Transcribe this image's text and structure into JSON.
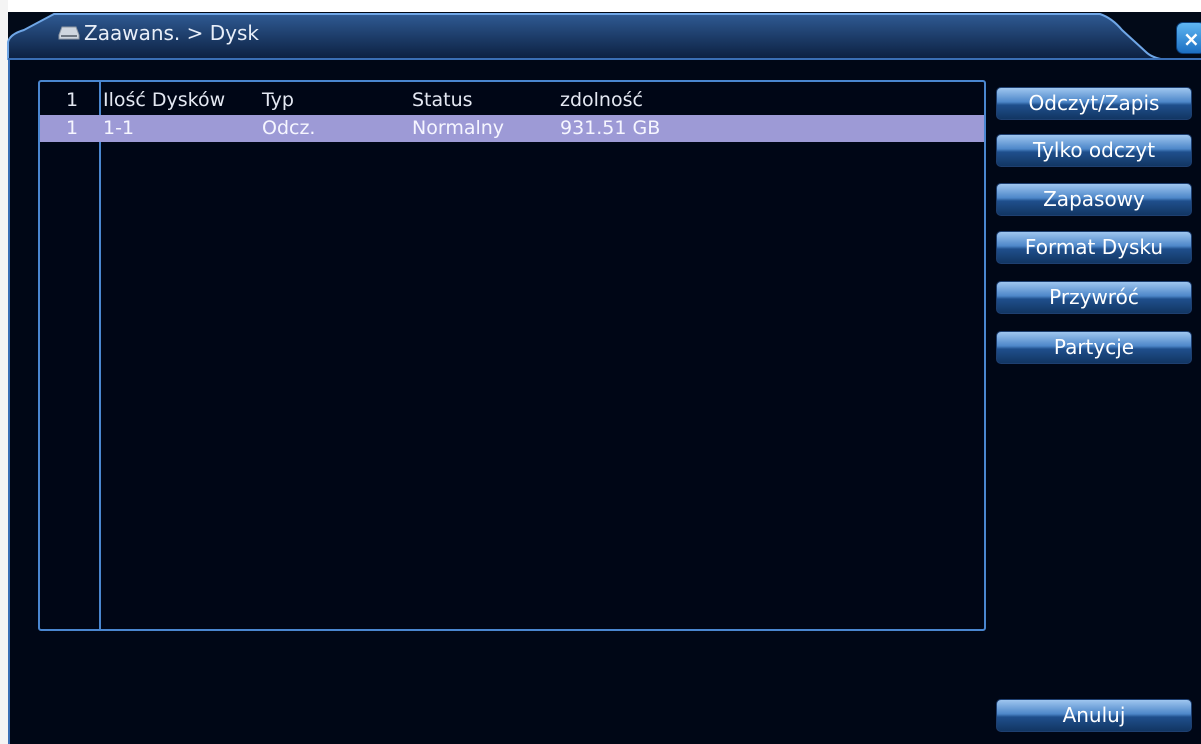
{
  "window": {
    "title": "Zaawans. > Dysk",
    "close_label": "×"
  },
  "table": {
    "headers": [
      "1",
      "Ilość Dysków",
      "Typ",
      "Status",
      "zdolność"
    ],
    "rows": [
      {
        "index": "1",
        "disks": "1-1",
        "type": "Odcz.",
        "status": "Normalny",
        "capacity": "931.51 GB"
      }
    ]
  },
  "buttons": {
    "read_write": "Odczyt/Zapis",
    "read_only": "Tylko odczyt",
    "backup": "Zapasowy",
    "format": "Format Dysku",
    "restore": "Przywróć",
    "partitions": "Partycje",
    "cancel": "Anuluj"
  },
  "colors": {
    "background": "#000716",
    "border_accent": "#4a86cf",
    "selected_row": "#9d9ad6",
    "button_gradient_top": "#9fc6ef",
    "button_gradient_bottom": "#123663"
  },
  "icons": {
    "title": "disk-drive-icon",
    "close": "close-icon"
  }
}
